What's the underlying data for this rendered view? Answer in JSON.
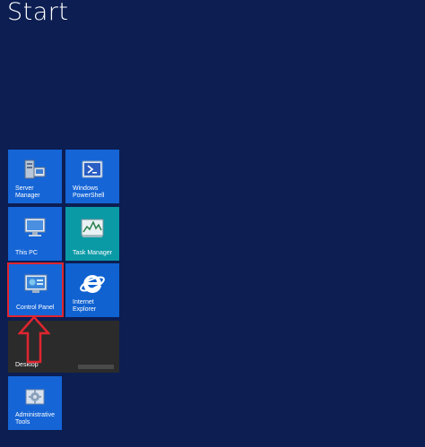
{
  "start": {
    "title": "Start"
  },
  "tiles": {
    "server_manager": {
      "label": "Server Manager"
    },
    "windows_powershell": {
      "label": "Windows\nPowerShell"
    },
    "this_pc": {
      "label": "This PC"
    },
    "task_manager": {
      "label": "Task Manager"
    },
    "control_panel": {
      "label": "Control Panel"
    },
    "internet_explorer": {
      "label": "Internet Explorer"
    },
    "desktop": {
      "label": "Desktop"
    },
    "administrative_tools": {
      "label": "Administrative\nTools"
    }
  },
  "icons": {
    "server_manager": "server-manager-icon",
    "windows_powershell": "powershell-icon",
    "this_pc": "computer-icon",
    "task_manager": "task-manager-icon",
    "control_panel": "control-panel-icon",
    "internet_explorer": "internet-explorer-icon",
    "administrative_tools": "admin-tools-icon",
    "annotation": "red-up-arrow-icon"
  },
  "colors": {
    "background": "#0c1e52",
    "tile_blue": "#1565d6",
    "tile_teal": "#0a9aa6",
    "tile_desktop": "#2b2b2b",
    "highlight": "#e0252f"
  }
}
